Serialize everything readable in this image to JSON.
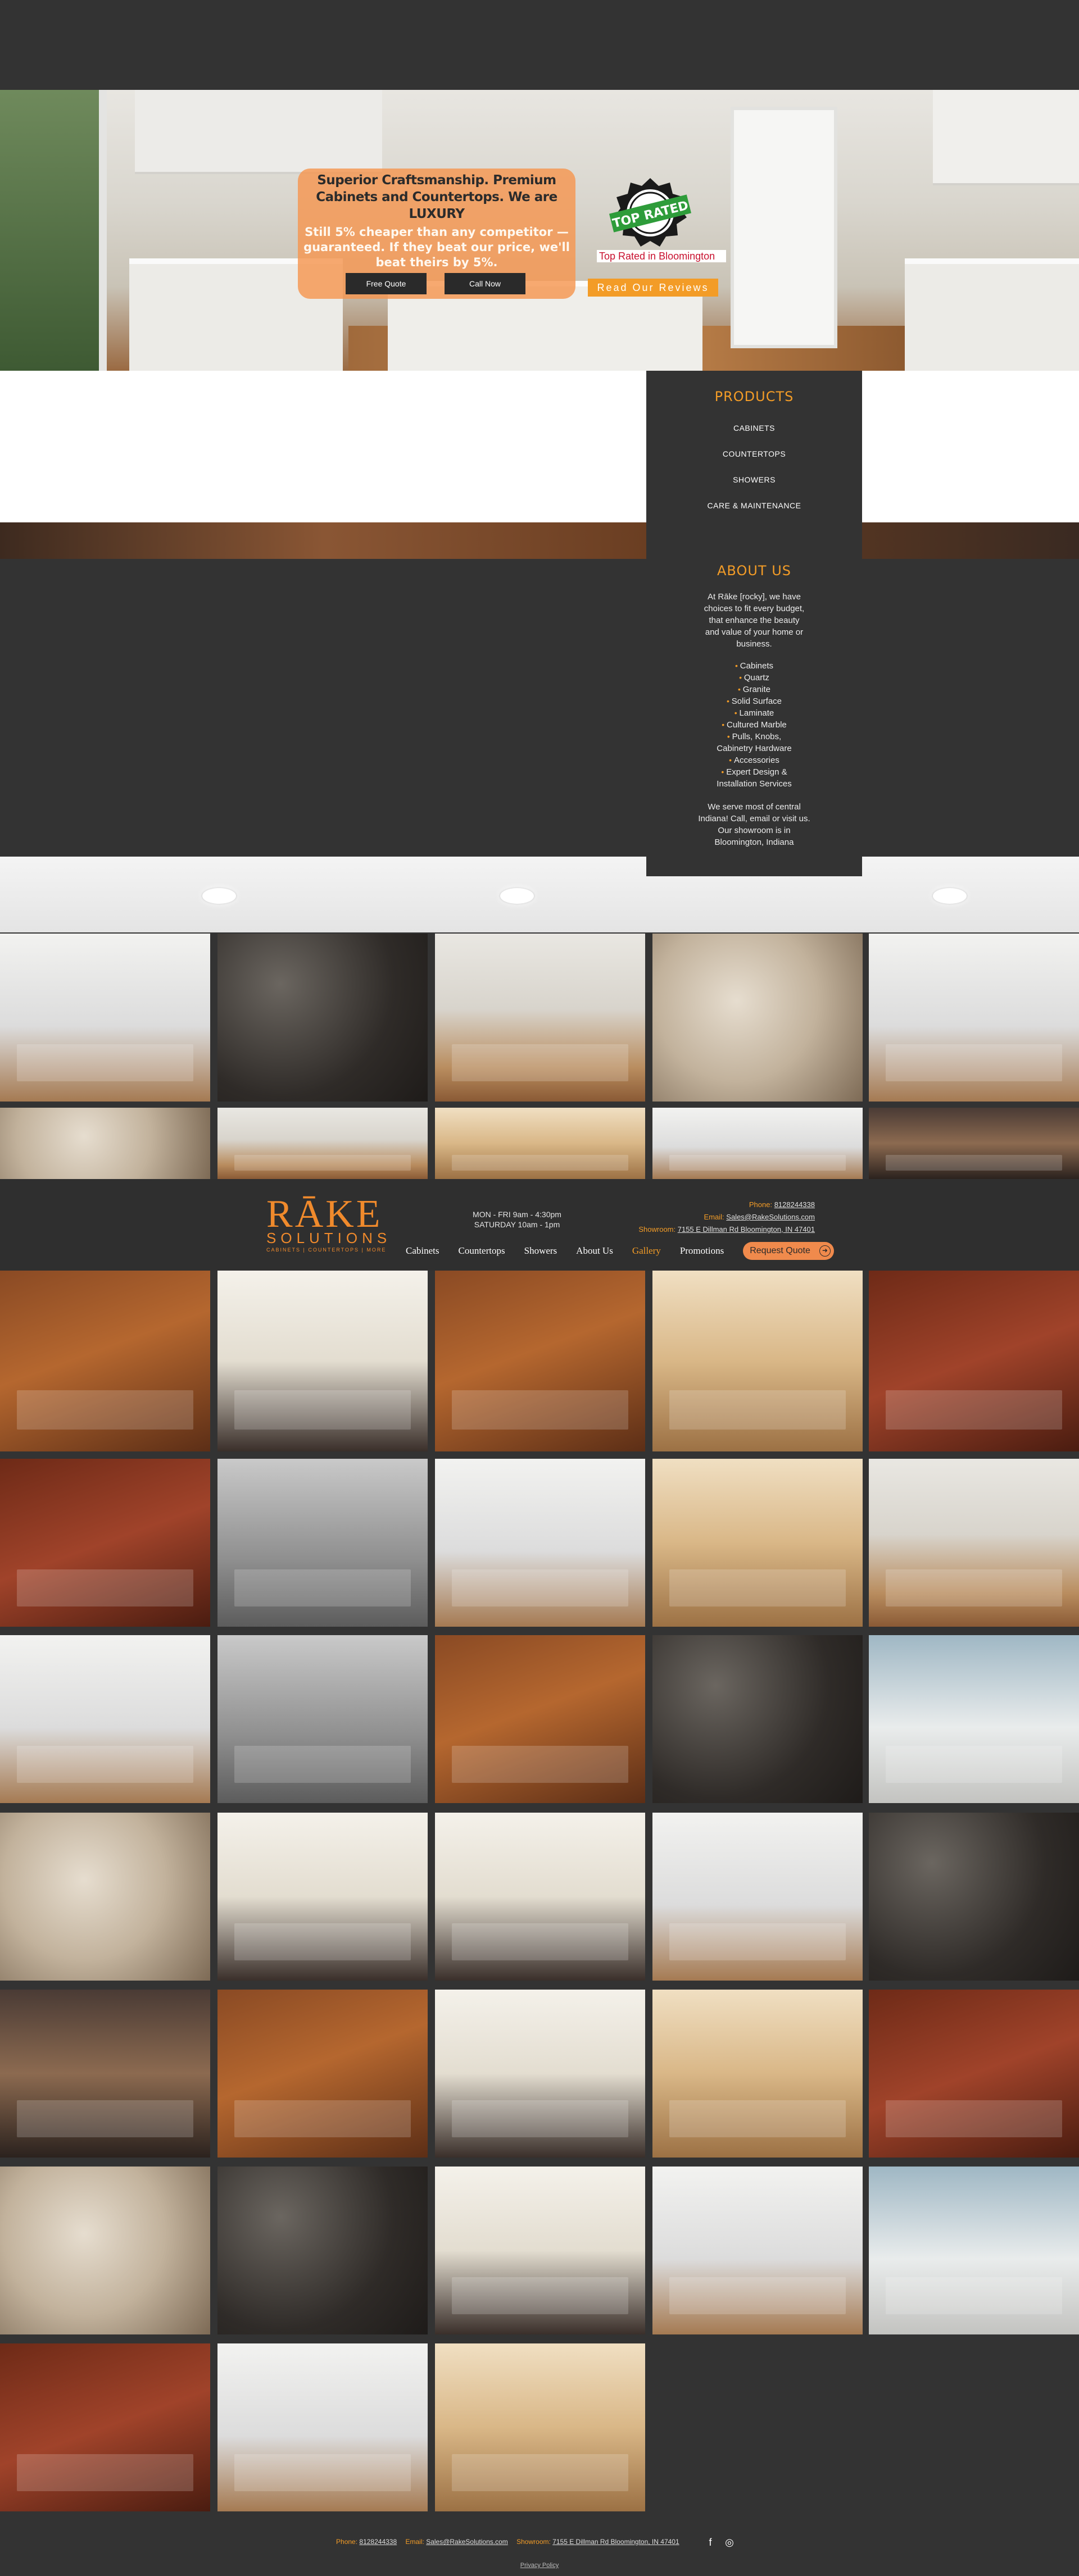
{
  "hero": {
    "headline": "Superior Craftsmanship.  Premium Cabinets and Countertops.  We are LUXURY",
    "subline": "Still 5% cheaper than any competitor — guaranteed. If they beat our price, we'll beat theirs by 5%.",
    "free_quote": "Free Quote",
    "call_now": "Call Now",
    "badge_rated_text": "Top Rated in Bloomington",
    "badge_seal_text": "TOP RATED",
    "reviews_button": "Read Our Reviews"
  },
  "products": {
    "heading": "PRODUCTS",
    "items": [
      "CABINETS",
      "COUNTERTOPS",
      "SHOWERS",
      "CARE & MAINTENANCE"
    ]
  },
  "about": {
    "heading": "ABOUT US",
    "intro": "At Rāke [rocky], we have choices to fit every budget, that enhance the beauty and value of your home or business.",
    "list_a": [
      "Cabinets",
      "Quartz",
      "Granite",
      "Solid Surface",
      "Laminate",
      "Cultured Marble",
      "Pulls, Knobs,"
    ],
    "list_a_continuation": "Cabinetry Hardware",
    "list_b": [
      "Accessories",
      "Expert Design &"
    ],
    "list_b_continuation": "Installation Services",
    "serve": "We serve most of central Indiana! Call, email or visit us. Our showroom is in Bloomington, Indiana"
  },
  "header": {
    "logo_word": "RĀKE",
    "logo_sub": "SOLUTIONS",
    "logo_tagline": "CABINETS | COUNTERTOPS | MORE",
    "hours_weekday": "MON - FRI   9am - 4:30pm",
    "hours_saturday": "SATURDAY  10am - 1pm",
    "phone_label": "Phone:",
    "phone": "8128244338",
    "email_label": "Email:",
    "email": "Sales@RakeSolutions.com",
    "showroom_label": "Showroom:",
    "showroom": "7155 E Dillman Rd Bloomington, IN 47401",
    "nav": [
      "Cabinets",
      "Countertops",
      "Showers",
      "About Us",
      "Gallery",
      "Promotions"
    ],
    "active_nav": "Gallery",
    "request_quote": "Request Quote"
  },
  "footer": {
    "phone_label": "Phone:",
    "phone": "8128244338",
    "email_label": "Email:",
    "email": "Sales@RakeSolutions.com",
    "showroom_label": "Showroom:",
    "showroom": "7155 E Dillman Rd Bloomington, IN 47401",
    "social": [
      "facebook-icon",
      "instagram-icon"
    ],
    "privacy": "Privacy Policy"
  },
  "colors": {
    "accent": "#f39c27",
    "dark_bg": "#333333",
    "promo_bg": "#f5964f"
  }
}
